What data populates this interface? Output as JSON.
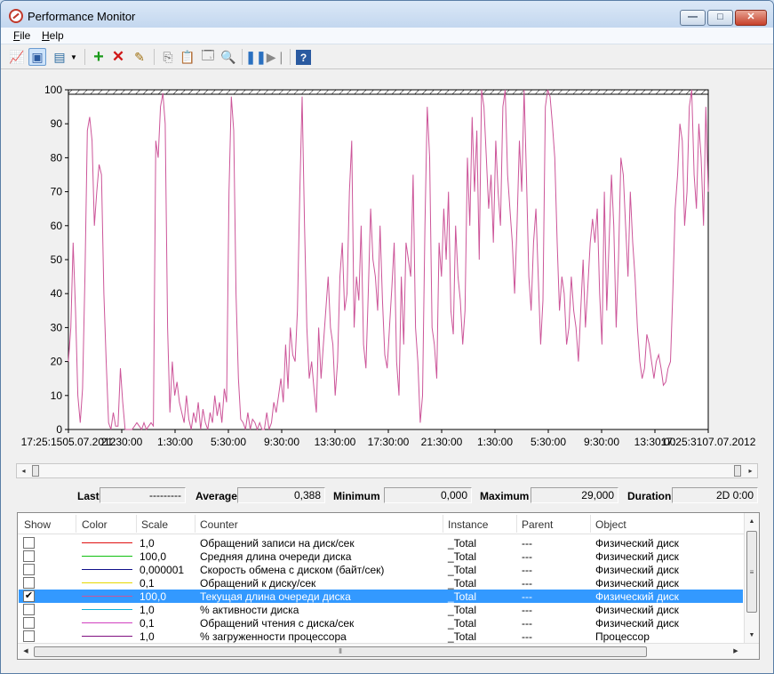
{
  "window": {
    "title": "Performance Monitor"
  },
  "menu": {
    "file": "File",
    "help": "Help"
  },
  "toolbar": {
    "icons": [
      "view-graph-icon",
      "change-graph-type-icon",
      "view-report-icon",
      "dropdown-icon",
      "add-counter-icon",
      "delete-counter-icon",
      "highlight-icon",
      "copy-properties-icon",
      "paste-counter-list-icon",
      "properties-icon",
      "zoom-icon",
      "freeze-display-icon",
      "update-data-icon",
      "help-icon"
    ]
  },
  "chart_data": {
    "type": "line",
    "ylim": [
      0,
      100
    ],
    "yticks": [
      "100",
      "90",
      "80",
      "70",
      "60",
      "50",
      "40",
      "30",
      "20",
      "10",
      "0"
    ],
    "xticks": [
      "17:25:1505.07.2012",
      "21:30:00",
      "1:30:00",
      "5:30:00",
      "9:30:00",
      "13:30:00",
      "17:30:00",
      "21:30:00",
      "1:30:00",
      "5:30:00",
      "9:30:00",
      "13:30:00",
      "17:25:3107.07.2012"
    ],
    "series": [
      {
        "name": "Текущая длина очереди диска",
        "color": "#cc5599",
        "values": [
          20,
          30,
          55,
          35,
          10,
          2,
          12,
          45,
          88,
          92,
          85,
          60,
          70,
          78,
          75,
          40,
          20,
          2,
          0,
          5,
          1,
          1,
          18,
          8,
          0,
          0,
          0,
          0,
          1,
          2,
          1,
          0,
          2,
          0,
          1,
          2,
          1,
          85,
          80,
          95,
          99,
          90,
          30,
          5,
          20,
          10,
          14,
          8,
          5,
          2,
          10,
          3,
          0,
          5,
          2,
          8,
          0,
          6,
          2,
          0,
          5,
          2,
          10,
          4,
          8,
          2,
          12,
          8,
          70,
          98,
          88,
          40,
          15,
          3,
          2,
          0,
          5,
          0,
          3,
          2,
          0,
          2,
          0,
          0,
          5,
          0,
          2,
          8,
          5,
          10,
          15,
          8,
          25,
          12,
          30,
          22,
          20,
          35,
          70,
          98,
          60,
          30,
          15,
          20,
          12,
          5,
          30,
          15,
          25,
          35,
          45,
          30,
          25,
          10,
          20,
          45,
          55,
          35,
          40,
          70,
          85,
          30,
          45,
          38,
          60,
          25,
          18,
          40,
          65,
          50,
          45,
          35,
          60,
          38,
          22,
          18,
          30,
          42,
          55,
          20,
          10,
          45,
          25,
          55,
          50,
          45,
          75,
          30,
          20,
          2,
          10,
          60,
          95,
          80,
          30,
          25,
          15,
          55,
          45,
          65,
          50,
          70,
          35,
          28,
          60,
          45,
          38,
          25,
          35,
          80,
          60,
          92,
          70,
          88,
          50,
          100,
          95,
          80,
          65,
          75,
          55,
          85,
          70,
          60,
          95,
          100,
          75,
          65,
          55,
          40,
          60,
          85,
          70,
          100,
          75,
          45,
          35,
          55,
          65,
          45,
          25,
          38,
          95,
          100,
          98,
          90,
          80,
          55,
          35,
          45,
          40,
          25,
          30,
          45,
          35,
          30,
          20,
          35,
          50,
          30,
          42,
          55,
          62,
          55,
          65,
          40,
          25,
          70,
          35,
          55,
          75,
          60,
          30,
          50,
          80,
          75,
          60,
          45,
          70,
          55,
          45,
          30,
          20,
          15,
          18,
          28,
          25,
          20,
          15,
          20,
          22,
          18,
          13,
          14,
          18,
          20,
          40,
          65,
          75,
          90,
          85,
          60,
          70,
          95,
          100,
          75,
          65,
          90,
          80,
          60,
          95,
          70
        ]
      }
    ]
  },
  "scrollbar": {
    "left": "◂",
    "right": "▸"
  },
  "stats": {
    "last_label": "Last",
    "last_value": "---------",
    "average_label": "Average",
    "average_value": "0,388",
    "minimum_label": "Minimum",
    "minimum_value": "0,000",
    "maximum_label": "Maximum",
    "maximum_value": "29,000",
    "duration_label": "Duration",
    "duration_value": "2D 0:00"
  },
  "legend": {
    "headers": {
      "show": "Show",
      "color": "Color",
      "scale": "Scale",
      "counter": "Counter",
      "instance": "Instance",
      "parent": "Parent",
      "object": "Object"
    },
    "rows": [
      {
        "checked": false,
        "color": "#e01010",
        "scale": "1,0",
        "counter": "Обращений записи на диск/сек",
        "instance": "_Total",
        "parent": "---",
        "object": "Физический диск"
      },
      {
        "checked": false,
        "color": "#10c010",
        "scale": "100,0",
        "counter": "Средняя длина очереди диска",
        "instance": "_Total",
        "parent": "---",
        "object": "Физический диск"
      },
      {
        "checked": false,
        "color": "#10108a",
        "scale": "0,000001",
        "counter": "Скорость обмена с диском (байт/сек)",
        "instance": "_Total",
        "parent": "---",
        "object": "Физический диск"
      },
      {
        "checked": false,
        "color": "#e6d800",
        "scale": "0,1",
        "counter": "Обращений к диску/сек",
        "instance": "_Total",
        "parent": "---",
        "object": "Физический диск"
      },
      {
        "checked": true,
        "selected": true,
        "color": "#cc5599",
        "scale": "100,0",
        "counter": "Текущая длина очереди диска",
        "instance": "_Total",
        "parent": "---",
        "object": "Физический диск"
      },
      {
        "checked": false,
        "color": "#10b0d8",
        "scale": "1,0",
        "counter": "% активности диска",
        "instance": "_Total",
        "parent": "---",
        "object": "Физический диск"
      },
      {
        "checked": false,
        "color": "#d040c0",
        "scale": "0,1",
        "counter": "Обращений чтения с диска/сек",
        "instance": "_Total",
        "parent": "---",
        "object": "Физический диск"
      },
      {
        "checked": false,
        "color": "#801080",
        "scale": "1,0",
        "counter": "% загруженности процессора",
        "instance": "_Total",
        "parent": "---",
        "object": "Процессор"
      }
    ]
  }
}
